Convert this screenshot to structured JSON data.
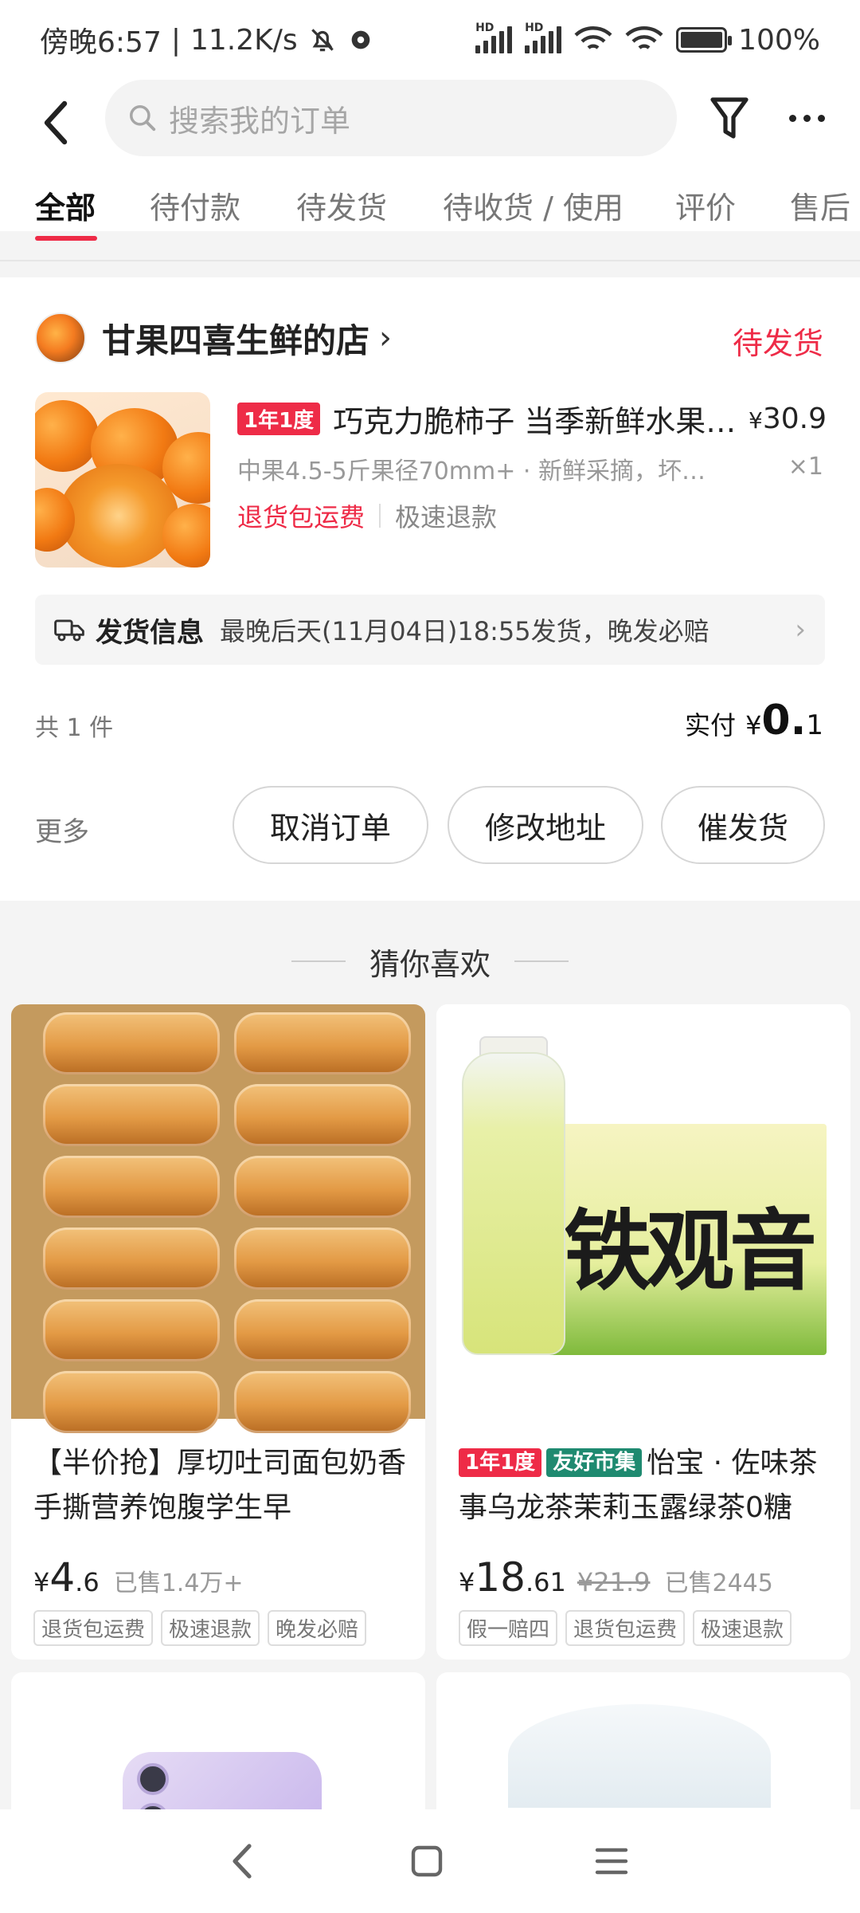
{
  "status_bar": {
    "time": "傍晚6:57",
    "speed": "11.2K/s",
    "network_1": "HD",
    "network_2": "HD",
    "battery": "100%"
  },
  "header": {
    "search_placeholder": "搜索我的订单"
  },
  "tabs": [
    "全部",
    "待付款",
    "待发货",
    "待收货 / 使用",
    "评价",
    "售后"
  ],
  "active_tab_index": 0,
  "order": {
    "shop_name": "甘果四喜生鲜的店",
    "status": "待发货",
    "product": {
      "badge": "1年1度",
      "title": "巧克力脆柿子 当季新鲜水果…",
      "price_currency": "¥",
      "price": "30.9",
      "spec": "中果4.5-5斤果径70mm+ · 新鲜采摘，坏…",
      "quantity": "×1",
      "tag_1": "退货包运费",
      "tag_2": "极速退款"
    },
    "shipping": {
      "label": "发货信息",
      "text": "最晚后天(11月04日)18:55发货，晚发必赔"
    },
    "count_text": "共 1 件",
    "paid_label": "实付",
    "paid_currency": "¥",
    "paid_int": "0.",
    "paid_dec": "1",
    "more_label": "更多",
    "buttons": {
      "cancel": "取消订单",
      "change_address": "修改地址",
      "urge": "催发货"
    }
  },
  "recommend": {
    "title": "猜你喜欢",
    "items": [
      {
        "name": "【半价抢】厚切吐司面包奶香手撕营养饱腹学生早",
        "currency": "¥",
        "price_int": "4",
        "price_dec": ".6",
        "sold": "已售1.4万+",
        "tags": [
          "退货包运费",
          "极速退款",
          "晚发必赔"
        ]
      },
      {
        "badge_1": "1年1度",
        "badge_2": "友好市集",
        "name": "怡宝 · 佐味茶事乌龙茶茉莉玉露绿茶0糖",
        "currency": "¥",
        "price_int": "18",
        "price_dec": ".61",
        "old_price": "¥21.9",
        "sold": "已售2445",
        "tags": [
          "假一赔四",
          "退货包运费",
          "极速退款"
        ],
        "image_text": "铁观音"
      }
    ]
  },
  "colors": {
    "accent": "#ee2b47",
    "badge_green": "#1f8a70",
    "background": "#f4f4f4"
  },
  "icons": {
    "back": "back-arrow-icon",
    "search": "search-icon",
    "filter": "filter-icon",
    "more": "more-icon",
    "truck": "truck-icon",
    "nav_back": "nav-back-icon",
    "nav_home": "nav-home-icon",
    "nav_menu": "nav-menu-icon"
  }
}
